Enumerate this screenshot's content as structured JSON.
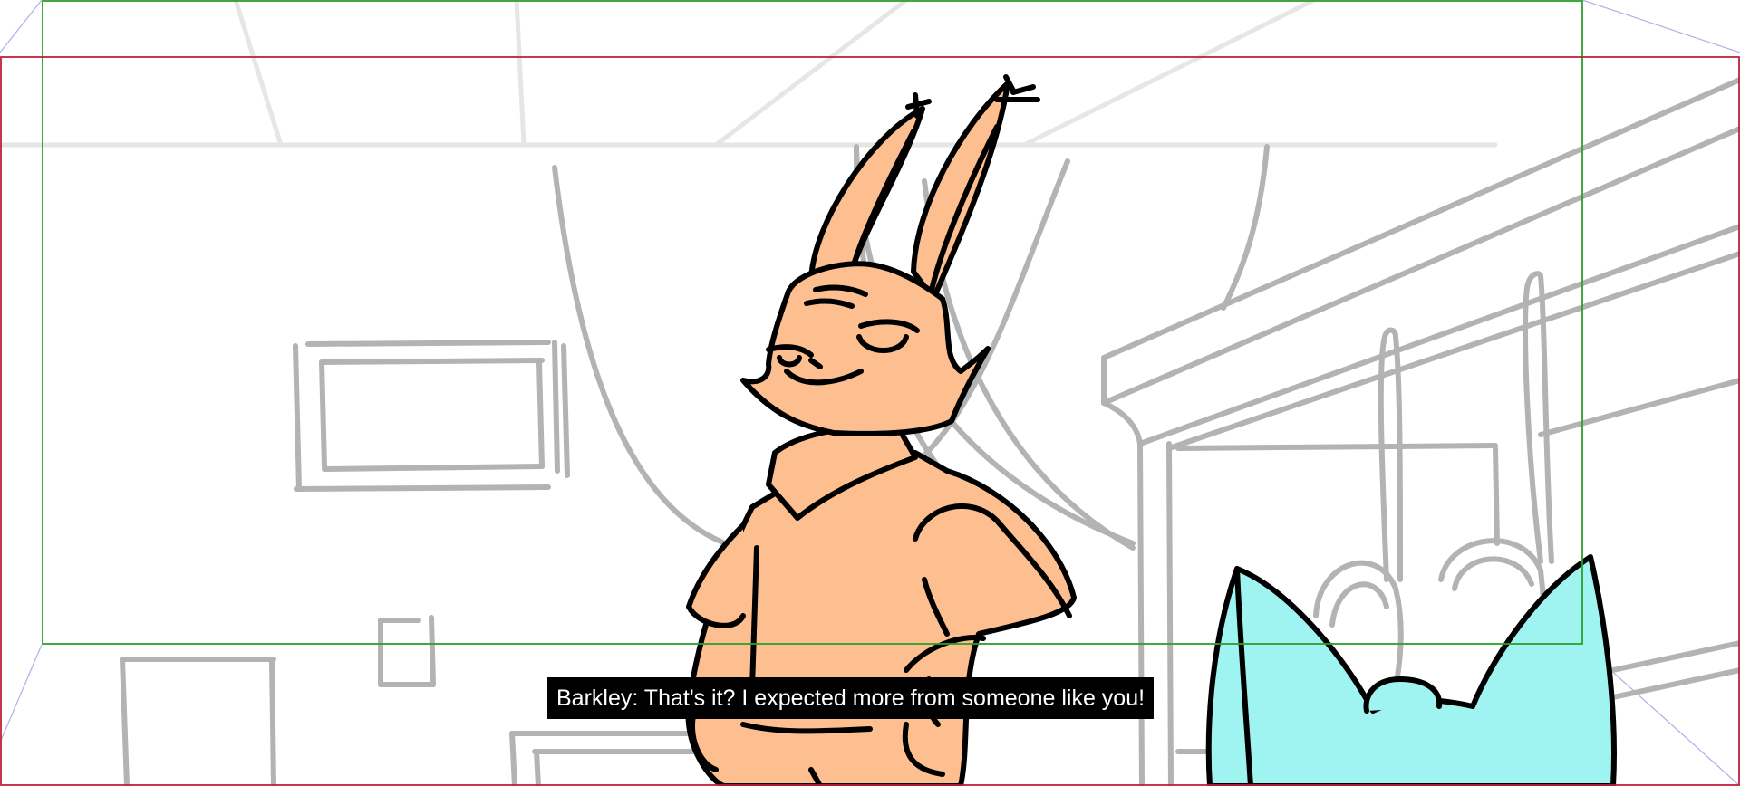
{
  "scene": {
    "subtitle": "Barkley: That's it? I expected more from someone like you!",
    "colors": {
      "background": "#ffffff",
      "sketch_lines": "#b3b3b3",
      "safe_frame": "#2aa02a",
      "camera_frame": "#c0203a",
      "perspective_guides": "#9a9ae6",
      "character_fill": "#fdbf8f",
      "character_outline": "#000000",
      "second_character_fill": "#9ff3f0",
      "subtitle_background": "#000000",
      "subtitle_text": "#ffffff"
    }
  }
}
